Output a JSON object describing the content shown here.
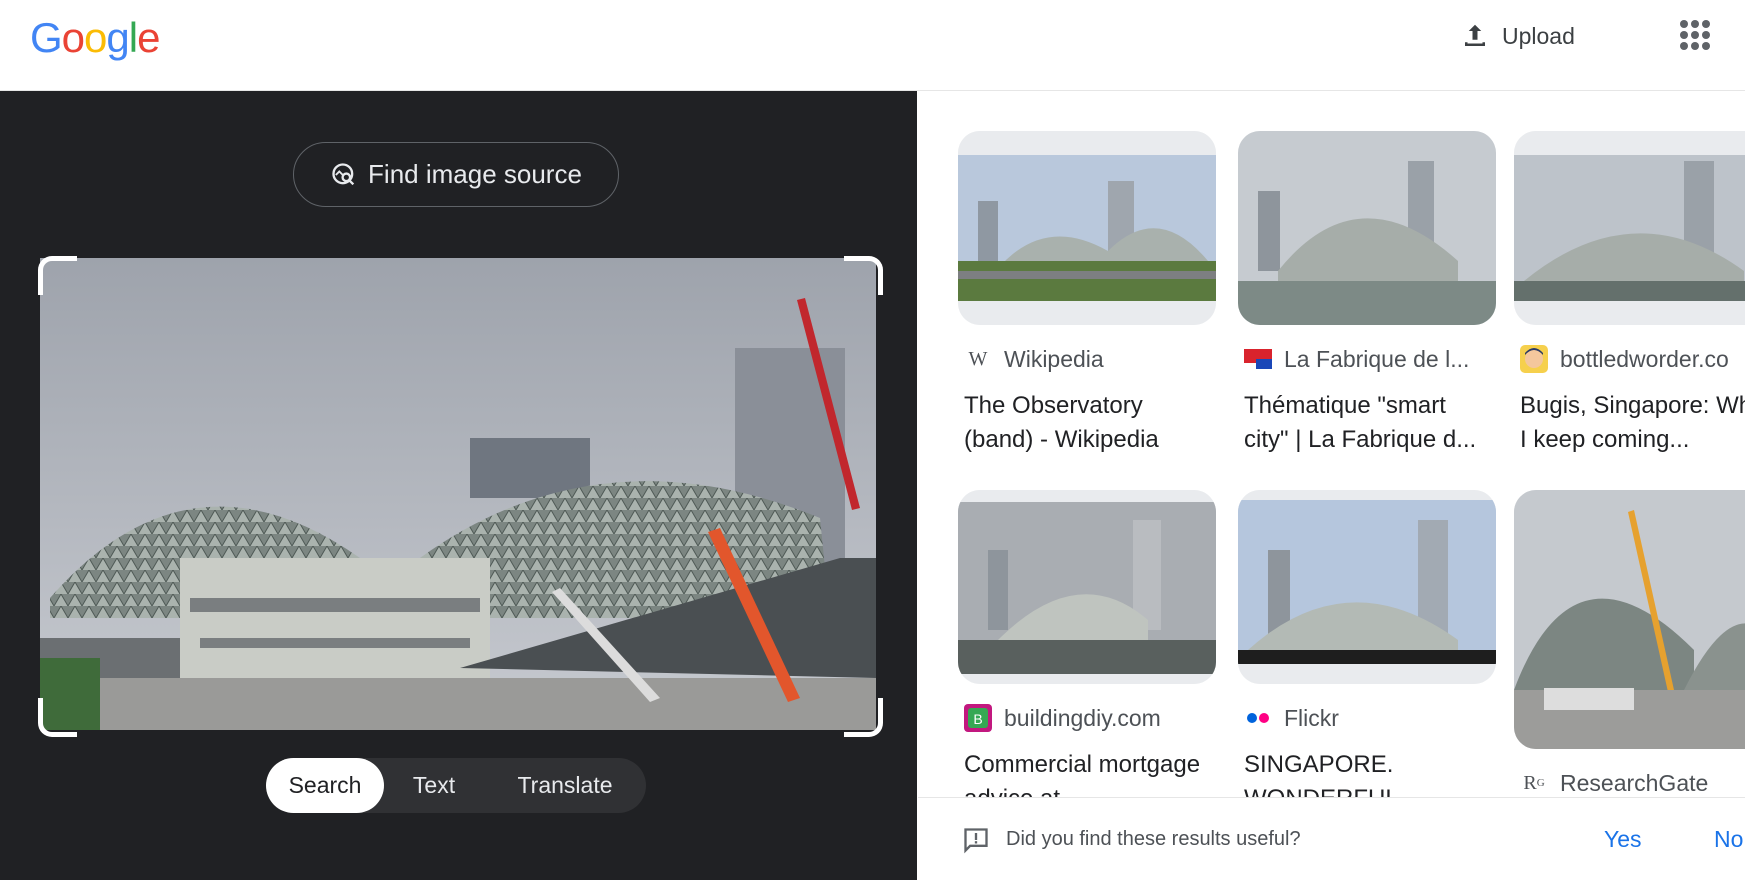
{
  "header": {
    "logo_letters": [
      "G",
      "o",
      "o",
      "g",
      "l",
      "e"
    ],
    "logo_colors": [
      "#4285F4",
      "#EA4335",
      "#FBBC05",
      "#4285F4",
      "#34A853",
      "#EA4335"
    ],
    "upload_label": "Upload",
    "upload_icon": "upload-icon",
    "apps_icon": "apps-grid-icon"
  },
  "left_panel": {
    "find_source_label": "Find image source",
    "find_source_icon": "image-search-icon",
    "modes": [
      {
        "label": "Search",
        "active": true
      },
      {
        "label": "Text",
        "active": false
      },
      {
        "label": "Translate",
        "active": false
      }
    ]
  },
  "results": [
    {
      "source": "Wikipedia",
      "title": "The Observatory (band) - Wikipedia",
      "icon": "wikipedia-icon"
    },
    {
      "source": "La Fabrique de l...",
      "title": "Thématique \"smart city\" | La Fabrique d...",
      "icon": "flag-icon"
    },
    {
      "source": "bottledworder.co",
      "title": "Bugis, Singapore: Why I keep coming...",
      "icon": "avatar-icon"
    },
    {
      "source": "buildingdiy.com",
      "title": "Commercial mortgage advice at",
      "icon": "buildingdiy-icon"
    },
    {
      "source": "Flickr",
      "title": "SINGAPORE. WONDERFUL",
      "icon": "flickr-icon"
    },
    {
      "source": "ResearchGate",
      "title": "",
      "icon": "researchgate-icon"
    }
  ],
  "feedback": {
    "question": "Did you find these results useful?",
    "yes_label": "Yes",
    "no_label": "No",
    "icon": "feedback-icon"
  },
  "colors": {
    "accent": "#1a73e8",
    "dark_panel": "#202124"
  }
}
